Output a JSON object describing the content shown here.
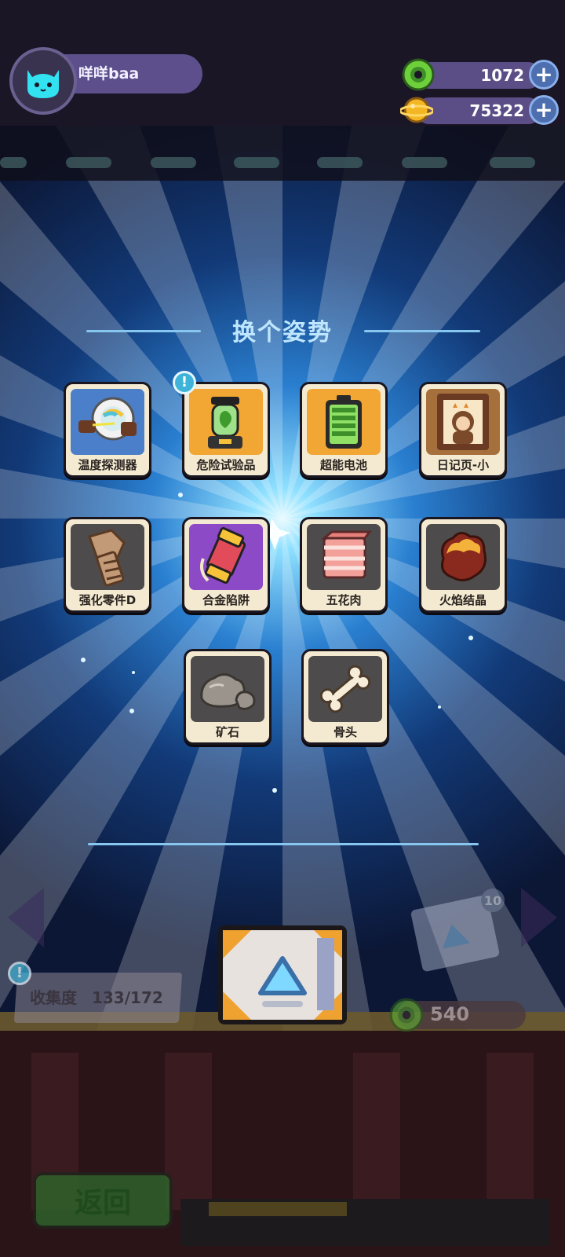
{
  "player": {
    "name": "咩咩baa",
    "avatar_icon": "cat-face-icon"
  },
  "currencies": [
    {
      "icon": "green-donut-coin-icon",
      "value": "1072",
      "add_icon": "plus-icon"
    },
    {
      "icon": "golden-planet-coin-icon",
      "value": "75322",
      "add_icon": "plus-icon"
    }
  ],
  "modal": {
    "title": "换个姿势",
    "items": [
      {
        "label": "温度探测器",
        "icon": "temperature-detector-icon",
        "bg": "blue"
      },
      {
        "label": "危险试验品",
        "icon": "hazard-specimen-jar-icon",
        "bg": "orange",
        "alert": "!"
      },
      {
        "label": "超能电池",
        "icon": "battery-icon",
        "bg": "orange"
      },
      {
        "label": "日记页-小",
        "icon": "diary-page-photo-icon",
        "bg": "brown"
      },
      {
        "label": "强化零件D",
        "icon": "bolt-part-icon",
        "bg": "grey"
      },
      {
        "label": "合金陷阱",
        "icon": "alloy-trap-icon",
        "bg": "purple"
      },
      {
        "label": "五花肉",
        "icon": "pork-belly-icon",
        "bg": "grey"
      },
      {
        "label": "火焰结晶",
        "icon": "flame-crystal-icon",
        "bg": "grey"
      },
      {
        "label": "矿石",
        "icon": "ore-rock-icon",
        "bg": "grey"
      },
      {
        "label": "骨头",
        "icon": "bone-icon",
        "bg": "grey"
      }
    ]
  },
  "stage": {
    "collection_label": "收集度",
    "collection_value": "133/172",
    "alert": "!",
    "price_icon": "green-donut-coin-icon",
    "price_value": "540",
    "side_box_badge": "10",
    "blind_box_icon": "blind-box-crate-icon"
  },
  "footer": {
    "back_label": "返回"
  },
  "colors": {
    "title": "#bfe6ff",
    "divider": "#86c6ef",
    "card": "#f4ead2",
    "accent_blue": "#3fb4d8"
  }
}
